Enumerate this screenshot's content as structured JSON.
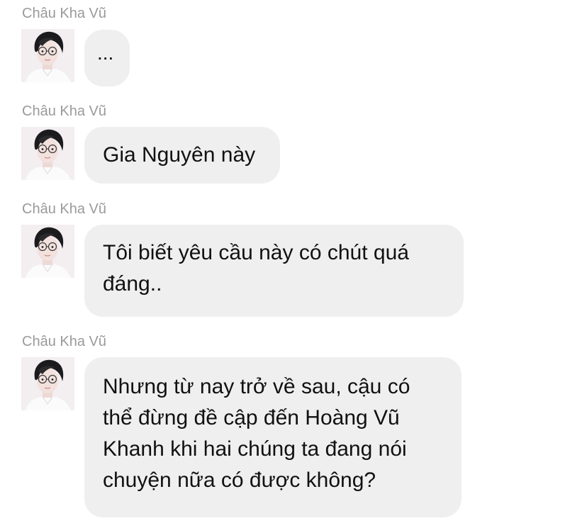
{
  "messages": [
    {
      "sender": "Châu Kha Vũ",
      "avatar_icon": "user-avatar-photo",
      "lines": [
        "..."
      ]
    },
    {
      "sender": "Châu Kha Vũ",
      "avatar_icon": "user-avatar-photo",
      "lines": [
        "Gia Nguyên này"
      ]
    },
    {
      "sender": "Châu Kha Vũ",
      "avatar_icon": "user-avatar-photo",
      "lines": [
        "Tôi biết yêu cầu này có chút quá",
        "đáng.."
      ]
    },
    {
      "sender": "Châu Kha Vũ",
      "avatar_icon": "user-avatar-photo",
      "lines": [
        "Nhưng từ nay trở về sau, cậu có",
        "thể đừng đề cập đến Hoàng Vũ",
        "Khanh khi hai chúng ta đang nói",
        "chuyện nữa có được không?"
      ]
    }
  ]
}
